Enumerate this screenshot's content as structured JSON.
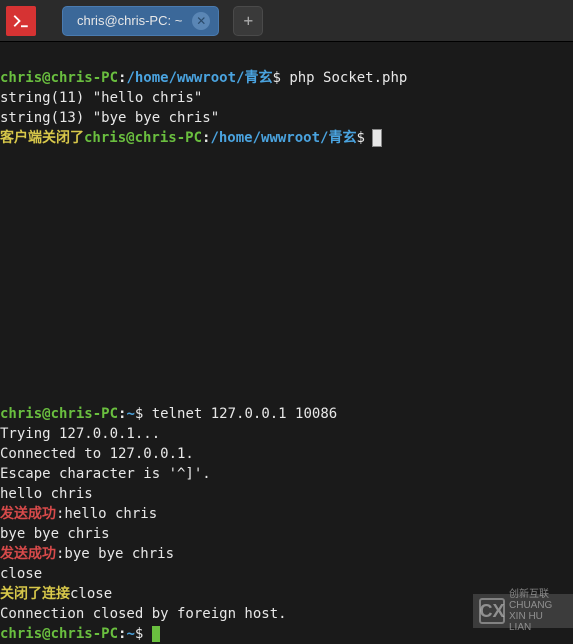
{
  "titlebar": {
    "tab_label": "chris@chris-PC: ~"
  },
  "pane1": {
    "prompt1_user": "chris@chris-PC",
    "prompt1_path": "/home/wwwroot/青玄",
    "prompt1_cmd": "php Socket.php",
    "line2": "string(11) \"hello chris\"",
    "line3": "string(13) \"bye bye chris\"",
    "line4_yellow": "客户端关闭了",
    "prompt2_user": "chris@chris-PC",
    "prompt2_path": "/home/wwwroot/青玄"
  },
  "pane2": {
    "prompt1_user": "chris@chris-PC",
    "prompt1_path": "~",
    "prompt1_cmd": "telnet 127.0.0.1 10086",
    "line2": "Trying 127.0.0.1...",
    "line3": "Connected to 127.0.0.1.",
    "line4": "Escape character is '^]'.",
    "line5": "hello chris",
    "line6_red": "发送成功",
    "line6_rest": ":hello chris",
    "line7": "bye bye chris",
    "line8_red": "发送成功",
    "line8_rest": ":bye bye chris",
    "line9": "close",
    "line10_yellow": "关闭了连接",
    "line10_rest": "close",
    "line11": "Connection closed by foreign host.",
    "prompt2_user": "chris@chris-PC",
    "prompt2_path": "~"
  },
  "watermark": {
    "icon_text": "CX",
    "line1": "创新互联",
    "line2": "CHUANG XIN HU LIAN"
  }
}
